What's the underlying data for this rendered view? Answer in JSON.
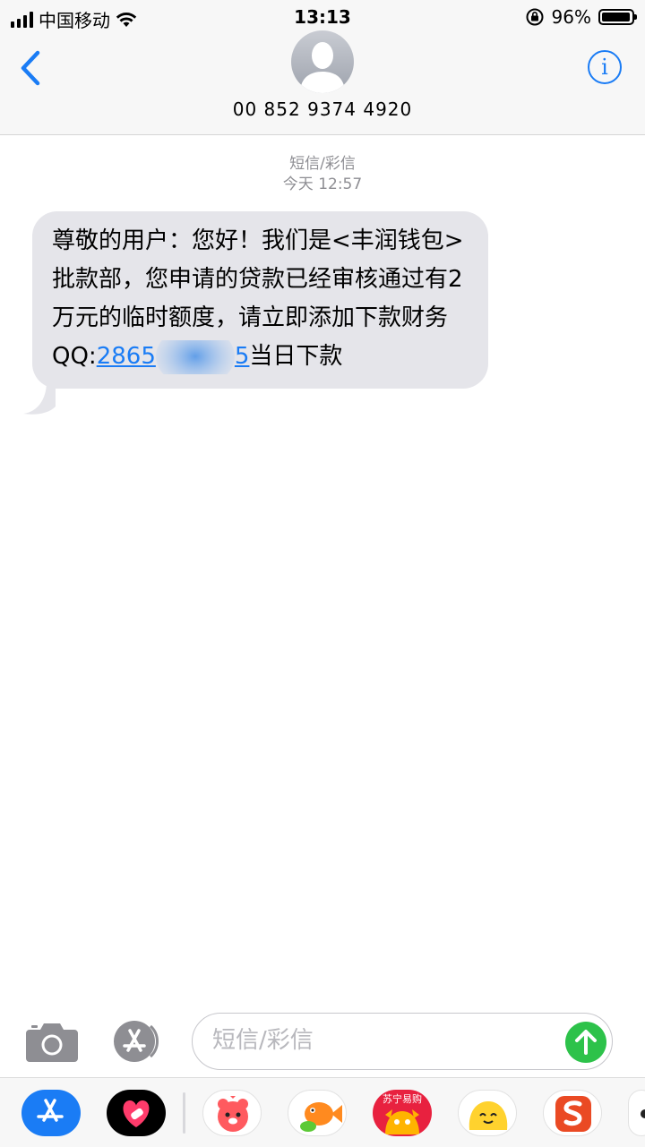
{
  "status_bar": {
    "carrier": "中国移动",
    "time": "13:13",
    "battery": "96%",
    "battery_level": 0.96
  },
  "header": {
    "contact": "00 852 9374 4920",
    "back_icon": "chevron-left-icon",
    "info_icon": "info-icon",
    "info_glyph": "i"
  },
  "conversation": {
    "service_label": "短信/彩信",
    "timestamp": "今天 12:57",
    "message": {
      "text_before": "尊敬的用户：您好！我们是<丰润钱包>批款部，您申请的贷款已经审核通过有2万元的临时额度，请立即添加下款财务QQ:",
      "qq_visible_start": "2865",
      "qq_visible_end": "5",
      "text_after": "当日下款"
    }
  },
  "input_bar": {
    "placeholder": "短信/彩信",
    "camera_icon": "camera-icon",
    "apps_icon": "app-store-icon",
    "send_icon": "send-arrow-icon"
  },
  "app_strip": {
    "apps": [
      {
        "name": "App Store",
        "icon": "app-store-icon",
        "color": "#1a7cf5"
      },
      {
        "name": "Digital Touch",
        "icon": "heart-icon",
        "color": "#000000"
      },
      {
        "name": "Bear Sticker",
        "icon": "bear-sticker-icon",
        "color": "#ff5a5f"
      },
      {
        "name": "Fish Sticker",
        "icon": "fish-sticker-icon",
        "color": "#ff8a1f"
      },
      {
        "name": "苏宁易购",
        "icon": "suning-icon",
        "color": "#e8213f"
      },
      {
        "name": "Emoji Sticker",
        "icon": "yellow-face-icon",
        "color": "#ffd22e"
      },
      {
        "name": "Sogou",
        "icon": "sogou-icon",
        "color": "#ea4a24"
      }
    ],
    "suning_label": "苏宁易购"
  },
  "colors": {
    "accent": "#1a7cf5",
    "bubble": "#e5e5ea",
    "send": "#2dc24a"
  }
}
